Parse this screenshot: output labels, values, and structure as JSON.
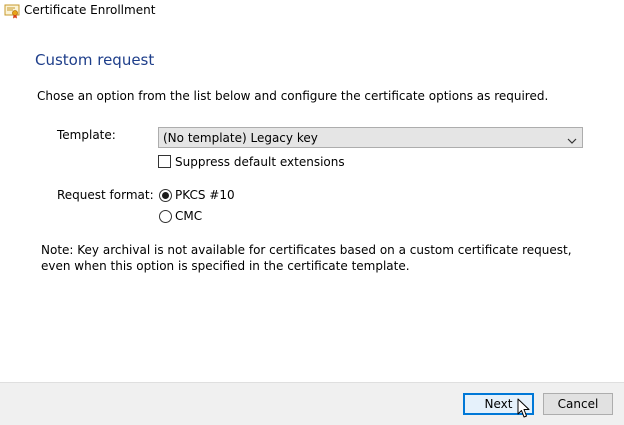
{
  "window": {
    "title": "Certificate Enrollment",
    "icon": "certificate-icon"
  },
  "page": {
    "heading": "Custom request",
    "instructions": "Chose an option from the list below and configure the certificate options as required."
  },
  "template": {
    "label": "Template:",
    "selected": "(No template) Legacy key",
    "suppress_label": "Suppress default extensions",
    "suppress_checked": false
  },
  "request_format": {
    "label": "Request format:",
    "options": [
      {
        "label": "PKCS #10",
        "selected": true
      },
      {
        "label": "CMC",
        "selected": false
      }
    ]
  },
  "note": "Note: Key archival is not available for certificates based on a custom certificate request, even when this option is specified in the certificate template.",
  "buttons": {
    "next": "Next",
    "cancel": "Cancel"
  },
  "colors": {
    "heading": "#1e3e8a",
    "focus_border": "#0078d7",
    "footer_bg": "#f0f0f0"
  }
}
